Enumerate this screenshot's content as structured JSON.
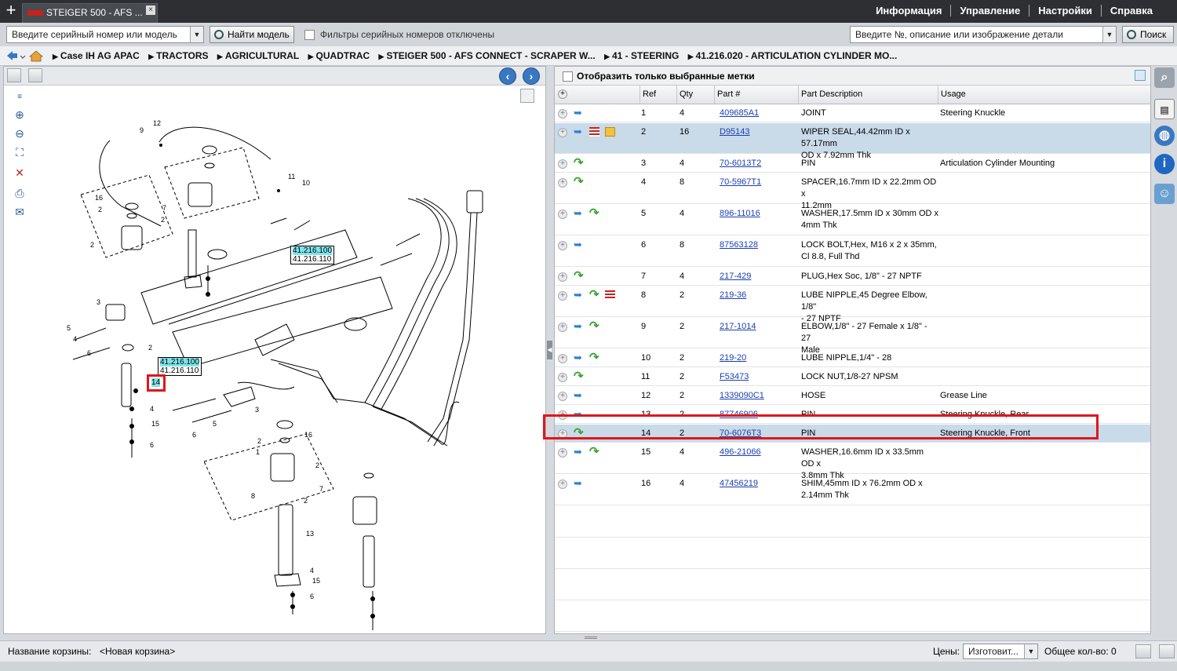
{
  "tabs": {
    "new_tab": "+",
    "active_tab": "STEIGER 500 - AFS ...",
    "close": "×"
  },
  "top_menu": [
    "Информация",
    "Управление",
    "Настройки",
    "Справка"
  ],
  "search": {
    "serial_placeholder": "Введите серийный номер или модель",
    "find_model_label": "Найти модель",
    "serial_filter_label": "Фильтры серийных номеров отключены",
    "part_placeholder": "Введите №, описание или изображение детали",
    "search_label": "Поиск"
  },
  "breadcrumb": [
    "Case IH AG APAC",
    "TRACTORS",
    "AGRICULTURAL",
    "QUADTRAC",
    "STEIGER 500 - AFS CONNECT - SCRAPER W...",
    "41 - STEERING",
    "41.216.020 - ARTICULATION CYLINDER MO..."
  ],
  "diagram": {
    "callouts": [
      {
        "line1": "41.216.100",
        "line2": "41.216.110"
      },
      {
        "line1": "41.216.100",
        "line2": "41.216.110"
      }
    ],
    "highlight_ref": "14",
    "ref_labels": [
      "12",
      "9",
      "11",
      "10",
      "16",
      "2",
      "7",
      "2",
      "2",
      "3",
      "5",
      "4",
      "6",
      "2",
      "4",
      "15",
      "6",
      "3",
      "5",
      "6",
      "16",
      "2",
      "1",
      "2",
      "7",
      "8",
      "2",
      "13",
      "4",
      "15",
      "6"
    ]
  },
  "parts_panel": {
    "show_selected_label": "Отобразить только выбранные метки",
    "columns": [
      "Ref",
      "Qty",
      "Part #",
      "Part Description",
      "Usage"
    ],
    "rows": [
      {
        "ref": "1",
        "qty": "4",
        "part": "409685A1",
        "desc1": "JOINT",
        "desc2": "",
        "usage": "Steering Knuckle"
      },
      {
        "ref": "2",
        "qty": "16",
        "part": "D95143",
        "desc1": "WIPER SEAL,44.42mm ID x 57.17mm",
        "desc2": "OD x 7.92mm Thk",
        "usage": ""
      },
      {
        "ref": "3",
        "qty": "4",
        "part": "70-6013T2",
        "desc1": "PIN",
        "desc2": "",
        "usage": "Articulation Cylinder Mounting"
      },
      {
        "ref": "4",
        "qty": "8",
        "part": "70-5967T1",
        "desc1": "SPACER,16.7mm ID x 22.2mm OD x",
        "desc2": "11.2mm",
        "usage": ""
      },
      {
        "ref": "5",
        "qty": "4",
        "part": "896-11016",
        "desc1": "WASHER,17.5mm ID x 30mm OD x",
        "desc2": "4mm Thk",
        "usage": ""
      },
      {
        "ref": "6",
        "qty": "8",
        "part": "87563128",
        "desc1": "LOCK BOLT,Hex, M16 x 2 x 35mm,",
        "desc2": "Cl 8.8, Full Thd",
        "usage": ""
      },
      {
        "ref": "7",
        "qty": "4",
        "part": "217-429",
        "desc1": "PLUG,Hex Soc, 1/8\" - 27 NPTF",
        "desc2": "",
        "usage": ""
      },
      {
        "ref": "8",
        "qty": "2",
        "part": "219-36",
        "desc1": "LUBE NIPPLE,45 Degree Elbow, 1/8\"",
        "desc2": "- 27 NPTF",
        "usage": ""
      },
      {
        "ref": "9",
        "qty": "2",
        "part": "217-1014",
        "desc1": "ELBOW,1/8\" - 27 Female x 1/8\" - 27",
        "desc2": "Male",
        "usage": ""
      },
      {
        "ref": "10",
        "qty": "2",
        "part": "219-20",
        "desc1": "LUBE NIPPLE,1/4\" - 28",
        "desc2": "",
        "usage": ""
      },
      {
        "ref": "11",
        "qty": "2",
        "part": "F53473",
        "desc1": "LOCK NUT,1/8-27 NPSM",
        "desc2": "",
        "usage": ""
      },
      {
        "ref": "12",
        "qty": "2",
        "part": "1339090C1",
        "desc1": "HOSE",
        "desc2": "",
        "usage": "Grease Line"
      },
      {
        "ref": "13",
        "qty": "2",
        "part": "87746906",
        "desc1": "PIN",
        "desc2": "",
        "usage": "Steering Knuckle, Rear"
      },
      {
        "ref": "14",
        "qty": "2",
        "part": "70-6076T3",
        "desc1": "PIN",
        "desc2": "",
        "usage": "Steering Knuckle, Front"
      },
      {
        "ref": "15",
        "qty": "4",
        "part": "496-21066",
        "desc1": "WASHER,16.6mm ID x 33.5mm OD x",
        "desc2": "3.8mm Thk",
        "usage": ""
      },
      {
        "ref": "16",
        "qty": "4",
        "part": "47456219",
        "desc1": "SHIM,45mm ID x 76.2mm OD x",
        "desc2": "2.14mm Thk",
        "usage": ""
      }
    ]
  },
  "status": {
    "cart_label": "Название корзины:",
    "cart_value": "<Новая корзина>",
    "prices_label": "Цены:",
    "prices_value": "Изготовит...",
    "total_label": "Общее кол-во: 0"
  },
  "colors": {
    "accent_blue": "#3a78c2",
    "highlight_red": "#e0161b",
    "selected_row": "#c9dae9",
    "link": "#1a3fb3"
  }
}
